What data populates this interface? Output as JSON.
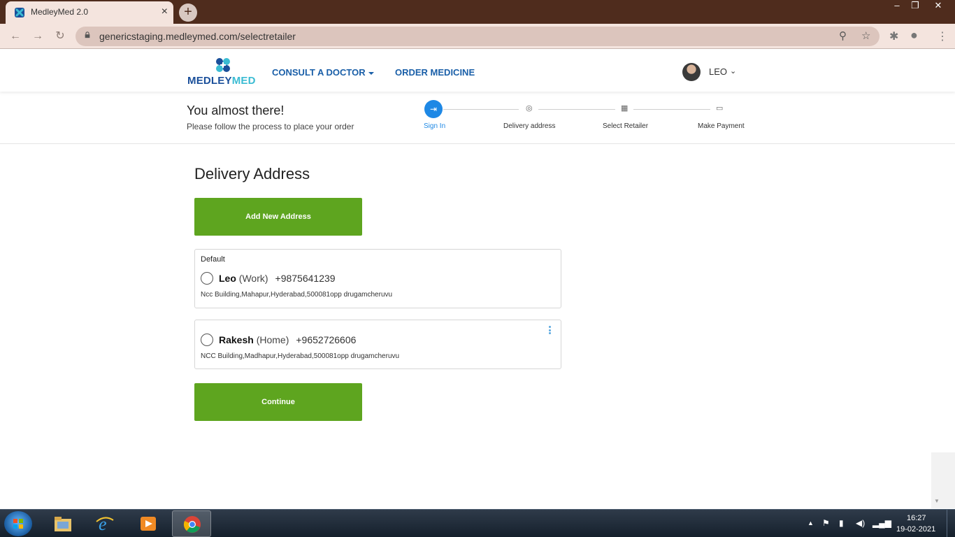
{
  "browser": {
    "tab_title": "MedleyMed 2.0",
    "tab_close": "×",
    "new_tab": "+",
    "url": "genericstaging.medleymed.com/selectretailer",
    "window_controls": [
      "–",
      "❐",
      "✕"
    ]
  },
  "header": {
    "logo_text_1": "MEDLEY",
    "logo_text_2": "MED",
    "nav": {
      "consult": "CONSULT A DOCTOR",
      "order": "ORDER MEDICINE"
    },
    "user_name": "LEO",
    "colors": {
      "nav_blue": "#1a5fa8",
      "logo_blue": "#1a4f9a",
      "logo_accent": "#3bbcd3"
    }
  },
  "progress": {
    "title": "You almost there!",
    "subtitle": "Please follow the process to place your order",
    "steps": [
      {
        "label": "Sign In",
        "icon": "sign-in-icon",
        "active": true
      },
      {
        "label": "Delivery address",
        "icon": "location-pin-icon",
        "active": false
      },
      {
        "label": "Select Retailer",
        "icon": "store-icon",
        "active": false
      },
      {
        "label": "Make Payment",
        "icon": "card-icon",
        "active": false
      }
    ],
    "colors": {
      "active": "#1e88e5"
    }
  },
  "main": {
    "title": "Delivery Address",
    "add_button": "Add New Address",
    "continue_button": "Continue",
    "addresses": [
      {
        "tag": "Default",
        "name": "Leo",
        "type": "(Work)",
        "phone": "+9875641239",
        "address": "Ncc Building,Mahapur,Hyderabad,500081opp drugamcheruvu"
      },
      {
        "tag": "",
        "name": "Rakesh",
        "type": "(Home)",
        "phone": "+9652726606",
        "address": "NCC Building,Madhapur,Hyderabad,500081opp drugamcheruvu"
      }
    ],
    "colors": {
      "button_green": "#5ea51f"
    }
  },
  "taskbar": {
    "time": "16:27",
    "date": "19-02-2021"
  }
}
